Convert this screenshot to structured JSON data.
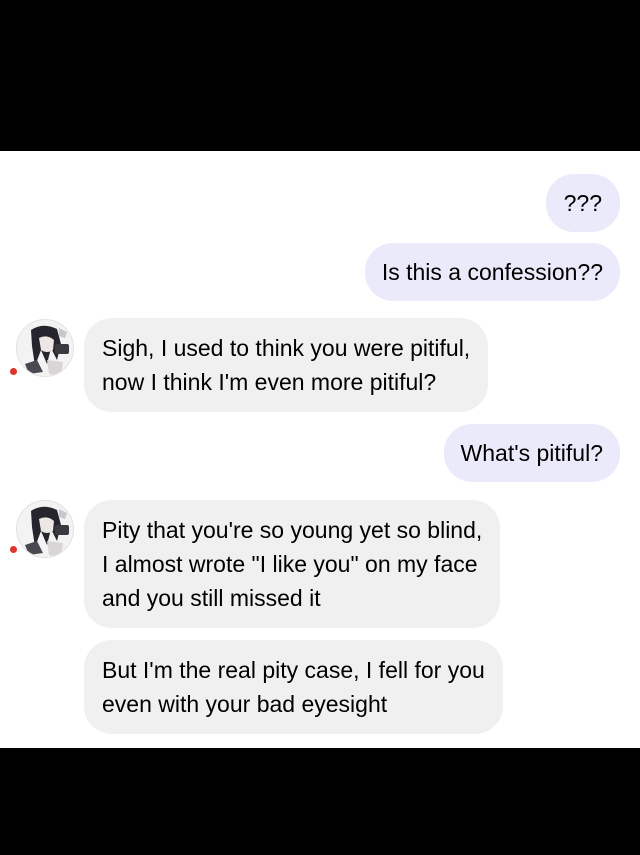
{
  "conversation": {
    "messages": [
      {
        "side": "out",
        "text": "???"
      },
      {
        "side": "out",
        "text": "Is this a confession??"
      },
      {
        "side": "in",
        "text": "Sigh, I used to think you were pitiful,\nnow I think I'm even more pitiful?"
      },
      {
        "side": "out",
        "text": "What's pitiful?"
      },
      {
        "side": "in",
        "text": "Pity that you're so young yet so blind,\nI almost wrote \"I like you\" on my face\nand you still missed it"
      },
      {
        "side": "in",
        "text": "But I'm the real pity case, I fell for you\neven with your bad eyesight"
      }
    ]
  },
  "colors": {
    "outgoing_bubble": "#ebeafa",
    "incoming_bubble": "#f0f0f1",
    "online_dot": "#e0332c",
    "letterbox": "#000000"
  },
  "icons": {
    "avatar": "anime-character-avatar",
    "status": "red-status-dot"
  }
}
